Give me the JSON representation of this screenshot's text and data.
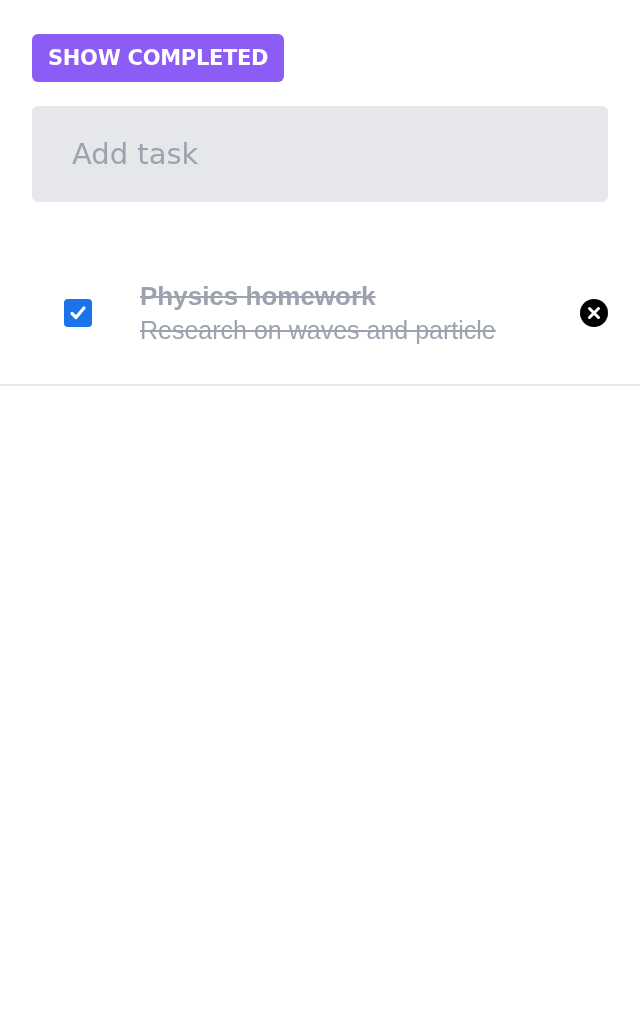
{
  "show_completed_button": {
    "label": "SHOW COMPLETED"
  },
  "add_task": {
    "placeholder": "Add task"
  },
  "tasks": [
    {
      "title": "Physics homework",
      "description": "Research on waves and particle",
      "checked": true
    }
  ]
}
